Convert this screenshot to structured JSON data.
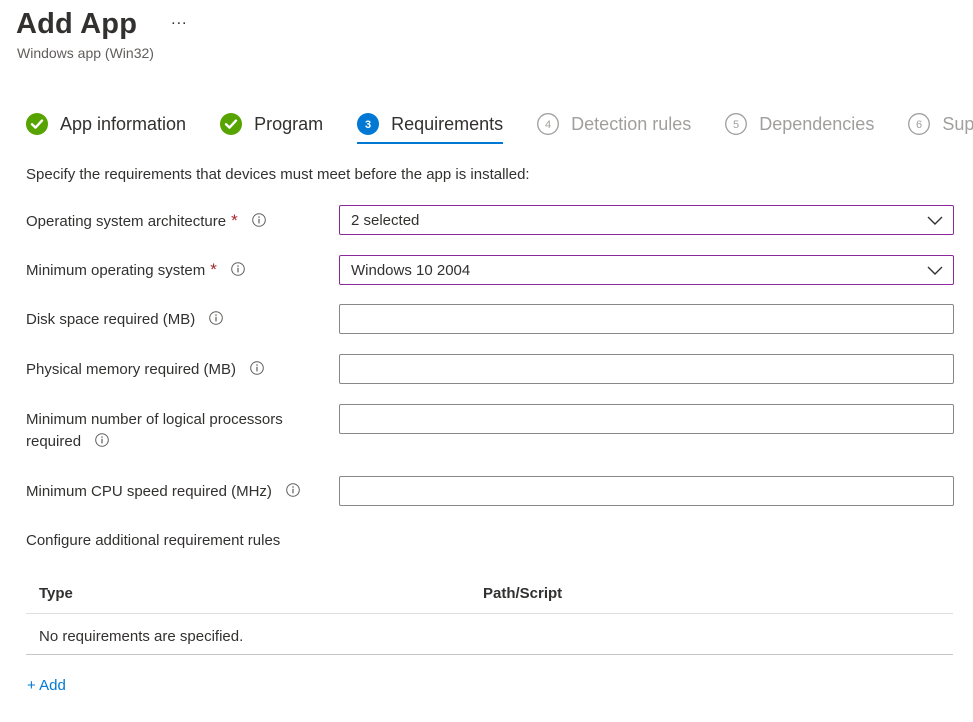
{
  "header": {
    "title": "Add App",
    "more_label": "...",
    "subtitle": "Windows app (Win32)"
  },
  "steps": [
    {
      "number": "",
      "label": "App information",
      "state": "completed",
      "icon": "check-circle-icon"
    },
    {
      "number": "",
      "label": "Program",
      "state": "completed",
      "icon": "check-circle-icon"
    },
    {
      "number": "3",
      "label": "Requirements",
      "state": "active",
      "icon": "step-number-icon"
    },
    {
      "number": "4",
      "label": "Detection rules",
      "state": "pending",
      "icon": "step-number-icon"
    },
    {
      "number": "5",
      "label": "Dependencies",
      "state": "pending",
      "icon": "step-number-icon"
    },
    {
      "number": "6",
      "label": "Supersedence",
      "state": "pending",
      "icon": "step-number-icon"
    }
  ],
  "intro": "Specify the requirements that devices must meet before the app is installed:",
  "form": {
    "os_architecture": {
      "label": "Operating system architecture",
      "required_mark": "*",
      "value": "2 selected"
    },
    "min_os": {
      "label": "Minimum operating system",
      "required_mark": "*",
      "value": "Windows 10 2004"
    },
    "disk_space": {
      "label": "Disk space required (MB)",
      "value": ""
    },
    "physical_memory": {
      "label": "Physical memory required (MB)",
      "value": ""
    },
    "logical_processors": {
      "label_line1": "Minimum number of logical processors",
      "label_line2": "required",
      "value": ""
    },
    "cpu_speed": {
      "label": "Minimum CPU speed required (MHz)",
      "value": ""
    }
  },
  "additional_rules": {
    "label": "Configure additional requirement rules",
    "columns": [
      "Type",
      "Path/Script"
    ],
    "empty_text": "No requirements are specified.",
    "add_label": "+ Add"
  },
  "colors": {
    "accent": "#0078d4",
    "success": "#57a300",
    "required": "#a4262c",
    "dropdown_border": "#8a2a9a"
  }
}
